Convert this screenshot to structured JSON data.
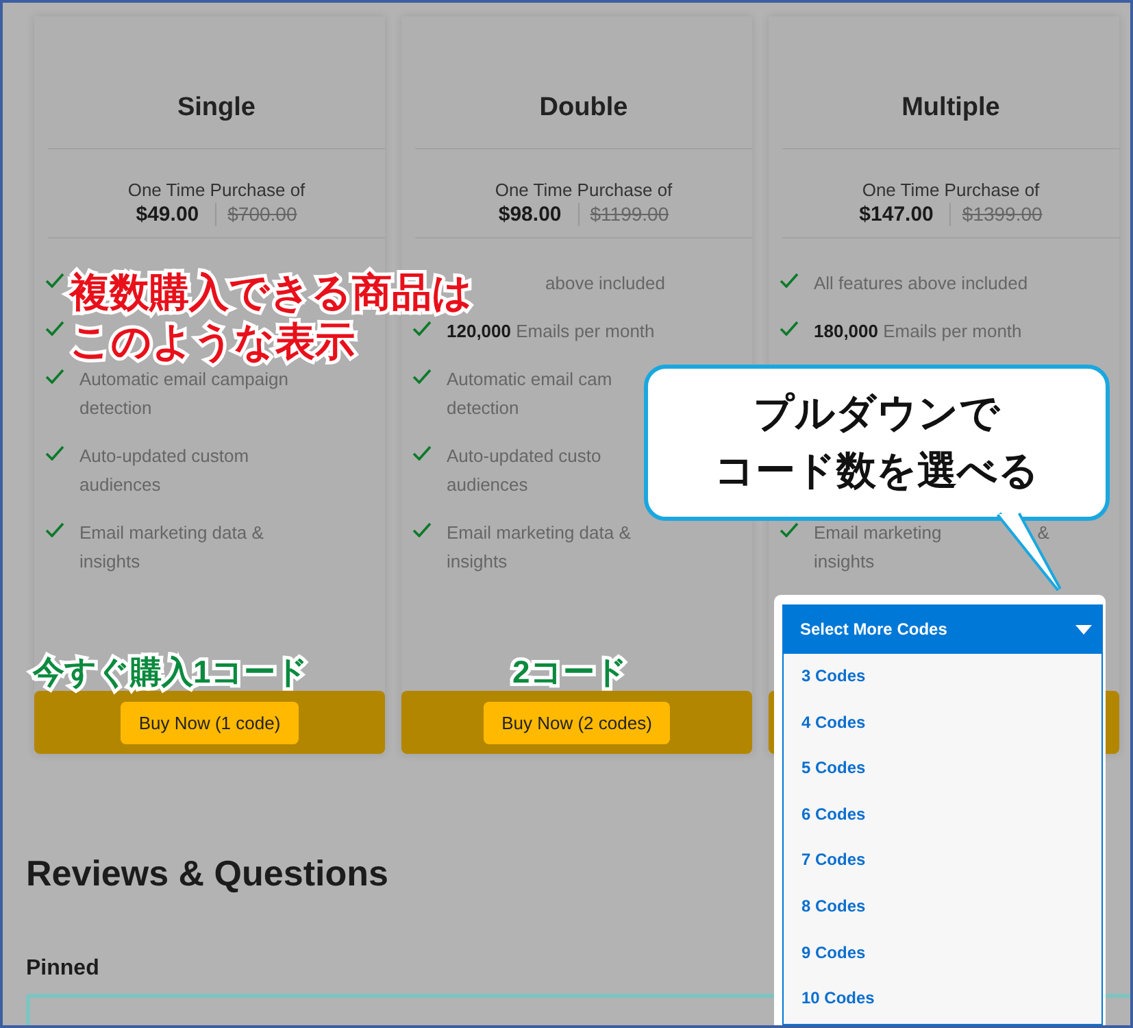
{
  "plans": [
    {
      "name": "Single",
      "purchase_label": "One Time Purchase of",
      "price": "$49.00",
      "original_price": "$700.00",
      "button": "Buy Now (1 code)",
      "features": [
        {
          "kind": "covered"
        },
        {
          "kind": "covered"
        },
        {
          "kind": "check",
          "lines": [
            [
              "Automatic email campaign"
            ],
            [
              "detection"
            ]
          ]
        },
        {
          "kind": "check",
          "lines": [
            [
              "Auto-updated custom"
            ],
            [
              "audiences"
            ]
          ]
        },
        {
          "kind": "check",
          "lines": [
            [
              "Email marketing data &"
            ],
            [
              "insights"
            ]
          ]
        }
      ]
    },
    {
      "name": "Double",
      "purchase_label": "One Time Purchase of",
      "price": "$98.00",
      "original_price": "$1199.00",
      "button": "Buy Now (2 codes)",
      "features": [
        {
          "kind": "tail",
          "lines": [
            [
              "above included"
            ]
          ]
        },
        {
          "kind": "check",
          "lines": [
            [
              "**120,000** Emails per month"
            ]
          ]
        },
        {
          "kind": "check",
          "lines": [
            [
              "Automatic email cam"
            ],
            [
              "detection"
            ]
          ]
        },
        {
          "kind": "check",
          "lines": [
            [
              "Auto-updated custo"
            ],
            [
              "audiences"
            ]
          ]
        },
        {
          "kind": "check",
          "lines": [
            [
              "Email marketing data &"
            ],
            [
              "insights"
            ]
          ]
        }
      ]
    },
    {
      "name": "Multiple",
      "purchase_label": "One Time Purchase of",
      "price": "$147.00",
      "original_price": "$1399.00",
      "features": [
        {
          "kind": "check",
          "lines": [
            [
              "All features above included"
            ]
          ]
        },
        {
          "kind": "check",
          "lines": [
            [
              "**180,000** Emails per month"
            ]
          ]
        },
        {
          "kind": "blank"
        },
        {
          "kind": "blank"
        },
        {
          "kind": "check",
          "lines": [
            [
              "Email marketing",
              "&"
            ],
            [
              "insights"
            ]
          ]
        }
      ]
    }
  ],
  "reviews": {
    "title": "Reviews & Questions",
    "pinned_label": "Pinned"
  },
  "dropdown": {
    "label": "Select More Codes",
    "options": [
      "3 Codes",
      "4 Codes",
      "5 Codes",
      "6 Codes",
      "7 Codes",
      "8 Codes",
      "9 Codes",
      "10 Codes"
    ]
  },
  "annotations": [
    {
      "kind": "red",
      "lines": [
        "複数購入できる商品は",
        "このような表示"
      ]
    },
    {
      "kind": "green-left",
      "lines": [
        "今すぐ購入1コード"
      ]
    },
    {
      "kind": "green-mid",
      "lines": [
        "2コード"
      ]
    },
    {
      "kind": "callout",
      "lines": [
        "プルダウンで",
        "コード数を選べる"
      ]
    }
  ]
}
